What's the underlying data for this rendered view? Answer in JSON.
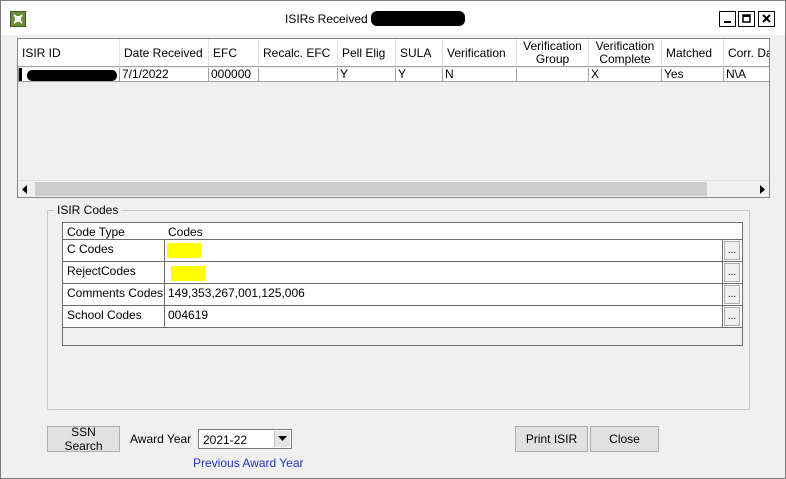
{
  "window": {
    "title": "ISIRs Received -",
    "controls": [
      "minimize",
      "maximize",
      "close"
    ]
  },
  "isir_grid": {
    "columns": [
      "ISIR ID",
      "Date Received",
      "EFC",
      "Recalc. EFC",
      "Pell Elig",
      "SULA",
      "Verification",
      "Verification Group",
      "Verification Complete",
      "Matched",
      "Corr. Da"
    ],
    "rows": [
      {
        "isir_id": "",
        "date_received": "7/1/2022",
        "efc": "000000",
        "recalc_efc": "",
        "pell_elig": "Y",
        "sula": "Y",
        "verification": "N",
        "verification_group": "",
        "verification_complete": "X",
        "matched": "Yes",
        "corr_date": "N\\A"
      }
    ]
  },
  "isir_codes": {
    "group_label": "ISIR Codes",
    "headers": [
      "Code Type",
      "Codes"
    ],
    "rows": [
      {
        "type": "C Codes",
        "codes": "",
        "ellipsis": "..."
      },
      {
        "type": "RejectCodes",
        "codes": "",
        "ellipsis": "..."
      },
      {
        "type": "Comments Codes",
        "codes": "149,353,267,001,125,006",
        "ellipsis": "..."
      },
      {
        "type": "School Codes",
        "codes": "004619",
        "ellipsis": "..."
      }
    ]
  },
  "footer": {
    "ssn_search_label": "SSN Search",
    "award_year_label": "Award Year",
    "award_year_value": "2021-22",
    "previous_award_year_link": "Previous Award Year",
    "print_isir_label": "Print ISIR",
    "close_label": "Close"
  },
  "colors": {
    "highlight": "#ffff00",
    "link": "#1a33c4",
    "redaction": "#000000"
  }
}
